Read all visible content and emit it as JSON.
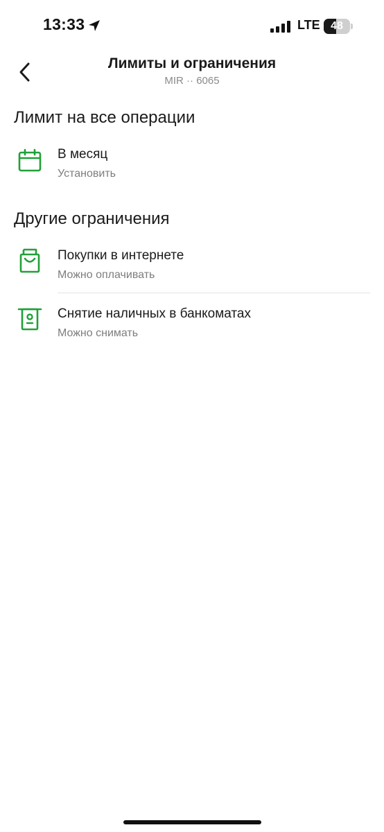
{
  "status_bar": {
    "time": "13:33",
    "network": "LTE",
    "battery_level": "48",
    "battery_fraction": 0.48
  },
  "header": {
    "title": "Лимиты и ограничения",
    "subtitle": "MIR ·· 6065"
  },
  "sections": {
    "limits": {
      "title": "Лимит на все операции",
      "items": [
        {
          "label": "В месяц",
          "sub": "Установить",
          "icon": "calendar-icon"
        }
      ]
    },
    "restrictions": {
      "title": "Другие ограничения",
      "items": [
        {
          "label": "Покупки в интернете",
          "sub": "Можно оплачивать",
          "icon": "shopping-bag-icon"
        },
        {
          "label": "Снятие наличных в банкоматах",
          "sub": "Можно снимать",
          "icon": "atm-icon"
        }
      ]
    }
  },
  "colors": {
    "accent": "#21a038",
    "text_primary": "#1a1a1a",
    "text_secondary": "#7d7d7d"
  }
}
